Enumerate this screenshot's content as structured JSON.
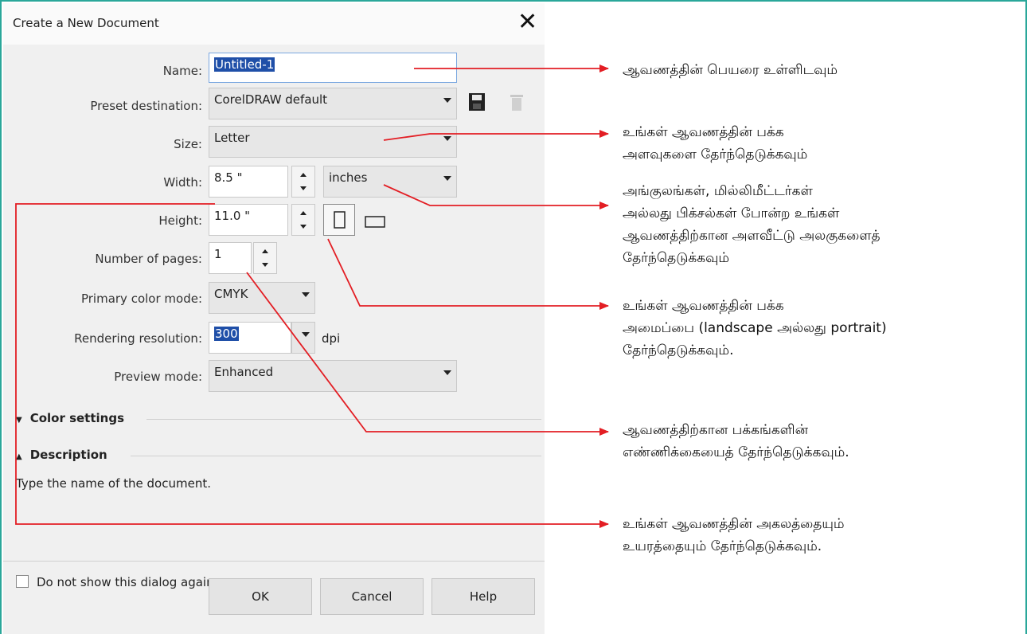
{
  "dialog": {
    "title": "Create a New Document",
    "close_glyph": "✕",
    "name": {
      "label": "Name:",
      "value": "Untitled-1"
    },
    "preset": {
      "label": "Preset destination:",
      "value": "CorelDRAW default"
    },
    "size": {
      "label": "Size:",
      "value": "Letter"
    },
    "width": {
      "label": "Width:",
      "value": "8.5 \"",
      "unit": "inches"
    },
    "height": {
      "label": "Height:",
      "value": "11.0 \""
    },
    "pages": {
      "label": "Number of pages:",
      "value": "1"
    },
    "color_mode": {
      "label": "Primary color mode:",
      "value": "CMYK"
    },
    "resolution": {
      "label": "Rendering resolution:",
      "value": "300",
      "unit": "dpi"
    },
    "preview": {
      "label": "Preview mode:",
      "value": "Enhanced"
    },
    "color_settings": "Color settings",
    "description": {
      "heading": "Description",
      "text": "Type the name of the document."
    },
    "dont_show": "Do not show this dialog again",
    "buttons": {
      "ok": "OK",
      "cancel": "Cancel",
      "help": "Help"
    }
  },
  "annotations": [
    "ஆவணத்தின் பெயரை உள்ளிடவும்",
    "உங்கள் ஆவணத்தின் பக்க\nஅளவுகளை தேர்ந்தெடுக்கவும்",
    "அங்குலங்கள், மில்லிமீட்டர்கள்\nஅல்லது பிக்சல்கள் போன்ற உங்கள்\nஆவணத்திற்கான அளவீட்டு அலகுகளைத்\nதேர்ந்தெடுக்கவும்",
    "உங்கள் ஆவணத்தின் பக்க\nஅமைப்பை (landscape அல்லது portrait)\nதேர்ந்தெடுக்கவும்.",
    "ஆவணத்திற்கான பக்கங்களின்\nஎண்ணிக்கையைத் தேர்ந்தெடுக்கவும்.",
    "உங்கள் ஆவணத்தின் அகலத்தையும்\nஉயரத்தையும் தேர்ந்தெடுக்கவும்."
  ],
  "colors": {
    "arrow": "#e31e24",
    "frame": "#2aa79a",
    "selection": "#1f4fa8"
  },
  "icons": {
    "save": "save-icon",
    "delete": "trash-icon",
    "portrait": "portrait-page-icon",
    "landscape": "landscape-page-icon"
  }
}
